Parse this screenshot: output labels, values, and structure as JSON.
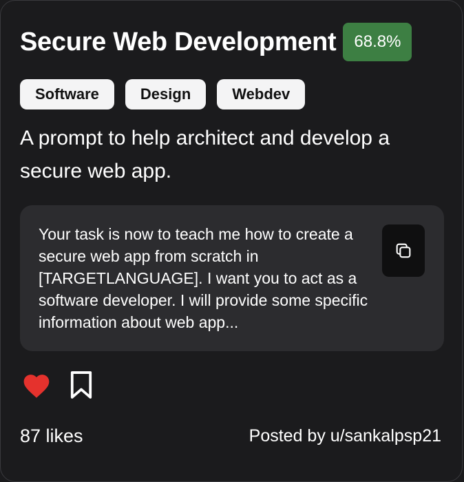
{
  "card": {
    "title": "Secure Web Development",
    "score": "68.8%",
    "tags": [
      "Software",
      "Design",
      "Webdev"
    ],
    "description": "A prompt to help architect and develop a secure web app.",
    "prompt_preview": "Your task is now to teach me how to create a secure web app from scratch in [TARGETLANGUAGE]. I want you to act as a software developer. I will provide some specific information about web app...",
    "likes": "87 likes",
    "posted_by": "Posted by u/sankalpsp21"
  },
  "icons": {
    "copy": "copy-icon",
    "like": "heart-icon",
    "save": "bookmark-icon"
  },
  "colors": {
    "background": "#1b1b1d",
    "score_badge": "#3d7f43",
    "tag_bg": "#f4f4f5",
    "prompt_bg": "#2c2c2f",
    "heart": "#e5322d"
  }
}
